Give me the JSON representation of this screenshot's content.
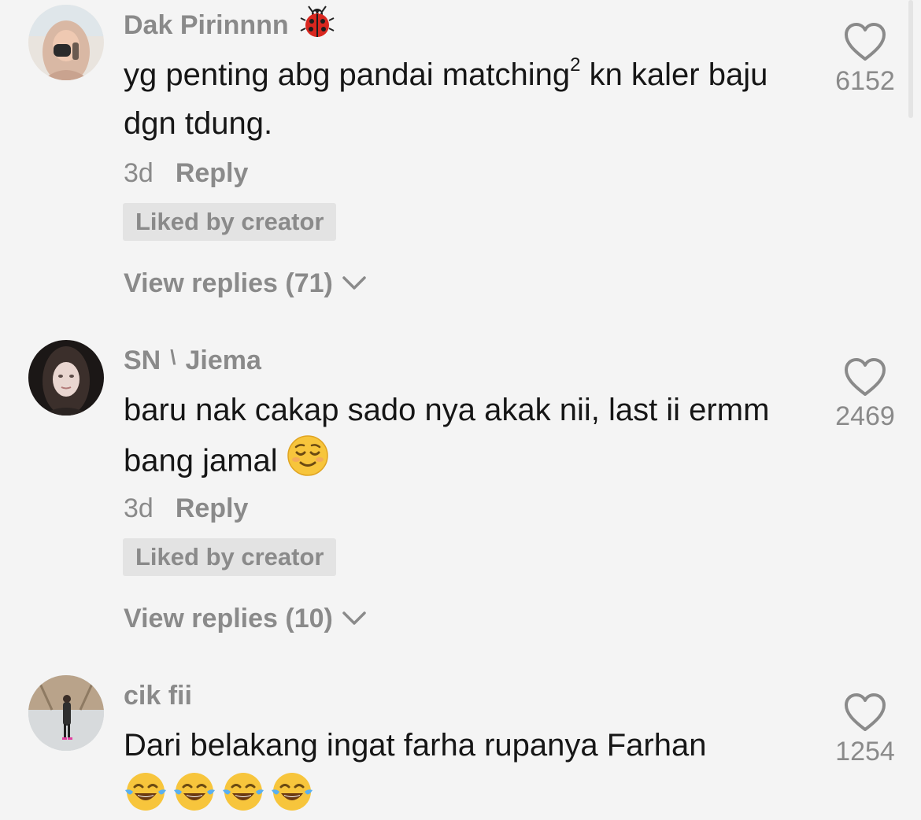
{
  "comments": [
    {
      "username": "Dak Pirinnnn",
      "username_emoji": "ladybug-icon",
      "text_main": "yg penting abg pandai matching",
      "text_sup": "2",
      "text_rest": " kn kaler baju dgn tdung.",
      "time": "3d",
      "reply_label": "Reply",
      "liked_by_creator": "Liked by creator",
      "view_replies": "View replies (71)",
      "like_count": "6152"
    },
    {
      "username_part1": "SN",
      "username_sep": "\\",
      "username_part2": "Jiema",
      "text": "baru nak cakap sado nya akak nii, last ii ermm bang jamal",
      "text_emoji": "relieved-face-icon",
      "time": "3d",
      "reply_label": "Reply",
      "liked_by_creator": "Liked by creator",
      "view_replies": "View replies (10)",
      "like_count": "2469"
    },
    {
      "username": "cik fii",
      "text": "Dari belakang ingat farha rupanya Farhan",
      "text_emojis": [
        "tears-of-joy-icon",
        "tears-of-joy-icon",
        "tears-of-joy-icon",
        "tears-of-joy-icon"
      ],
      "like_count": "1254"
    }
  ],
  "colors": {
    "background": "#f4f4f4",
    "text_primary": "#161616",
    "text_secondary": "#8a8a8a",
    "chip_bg": "#e3e3e3"
  }
}
